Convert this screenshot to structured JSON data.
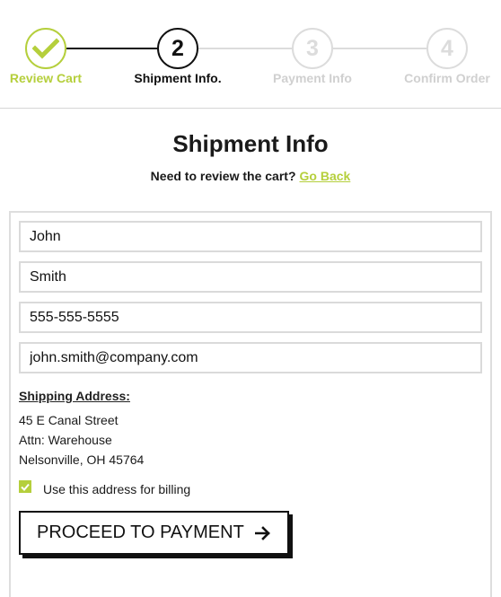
{
  "stepper": {
    "steps": [
      {
        "number": "",
        "label": "Review Cart",
        "state": "complete",
        "icon": "check-icon"
      },
      {
        "number": "2",
        "label": "Shipment Info.",
        "state": "active"
      },
      {
        "number": "3",
        "label": "Payment Info",
        "state": "upcoming"
      },
      {
        "number": "4",
        "label": "Confirm Order",
        "state": "upcoming"
      }
    ]
  },
  "header": {
    "title": "Shipment Info",
    "review_prompt": "Need to review the cart?",
    "go_back_label": "Go Back"
  },
  "form": {
    "first_name": "John",
    "last_name": "Smith",
    "phone": "555-555-5555",
    "email": "john.smith@company.com"
  },
  "shipping": {
    "heading": "Shipping Address:",
    "lines": [
      "45 E Canal Street",
      "Attn: Warehouse",
      "Nelsonville, OH 45764"
    ]
  },
  "billing": {
    "label": "Use this address for billing",
    "checked": true
  },
  "proceed_button": {
    "label": "PROCEED TO PAYMENT",
    "icon": "arrow-right-icon"
  },
  "colors": {
    "accent": "#b5cf3c",
    "inactive": "#dcdcdc",
    "text": "#111111"
  }
}
